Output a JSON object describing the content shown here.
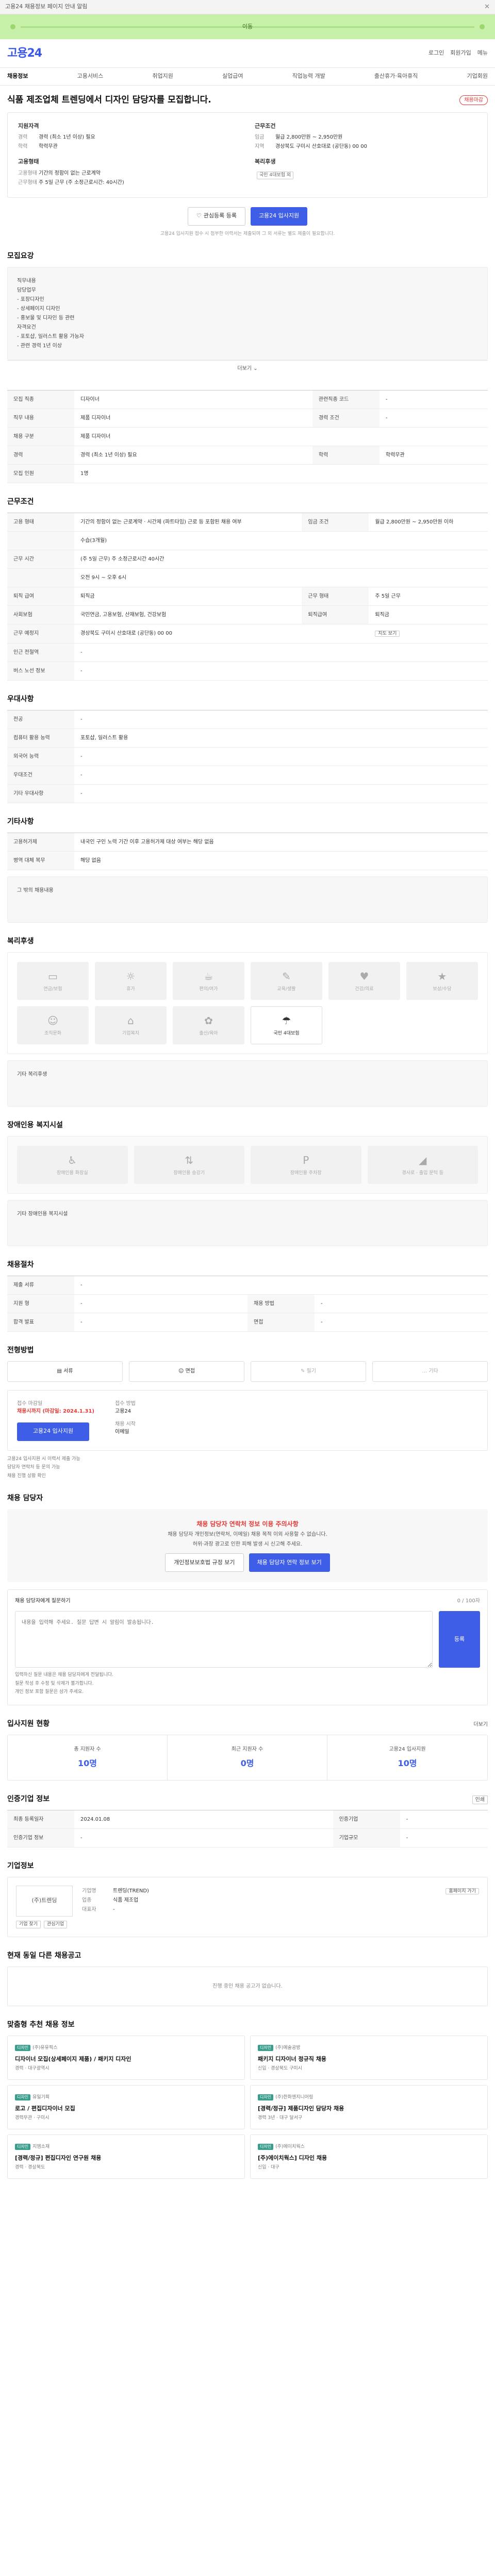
{
  "topbar": {
    "notice": "고용24 채용정보 페이지 안내 알림",
    "close": "✕"
  },
  "greenbar": {
    "text": "이동"
  },
  "header": {
    "logo": "고용24",
    "links": [
      "로그인",
      "회원가입",
      "메뉴"
    ]
  },
  "subnav": {
    "items": [
      "채용정보",
      "고용서비스",
      "취업지원",
      "실업급여",
      "직업능력 개발",
      "출산휴가·육아휴직",
      "기업회원"
    ]
  },
  "title": {
    "text": "식품 제조업체 트렌딩에서 디자인 담당자를 모집합니다.",
    "badge": "채용마감"
  },
  "summary": {
    "left_title": "지원자격",
    "left": [
      {
        "k": "경력",
        "v": "경력 (최소 1년 이상) 필요"
      },
      {
        "k": "학력",
        "v": "학력무관"
      }
    ],
    "left2_title": "고용형태",
    "left2": [
      {
        "k": "고용형태",
        "v": "기간의 정함이 없는 근로계약"
      },
      {
        "k": "근무형태",
        "v": "주 5일 근무 (주 소정근로시간: 40시간)"
      }
    ],
    "right_title": "근무조건",
    "right": [
      {
        "k": "임금",
        "v": "월급 2,800만원 ~ 2,950만원"
      },
      {
        "k": "지역",
        "v": "경상북도 구미시 산호대로 (공단동) 00 00"
      }
    ],
    "right2_title": "복리후생",
    "right2_tag": "국민 4대보험 외"
  },
  "cta": {
    "interest": "관심등록 등록",
    "apply": "고용24 입사지원",
    "note": "고용24 입사지원 접수 시 첨부한 이력서는 제출되며 그 외 서류는 별도 제출이 필요합니다."
  },
  "job_desc": {
    "heading": "모집요강",
    "lines": [
      "직무내용",
      "담당업무",
      "- 포장디자인",
      "- 상세페이지 디자인",
      "- 홍보물 및 디자인 등 관련",
      "자격요건",
      "- 포토샵, 일러스트 활용 가능자",
      "- 관련 경력 1년 이상"
    ],
    "more": "더보기"
  },
  "recruit": {
    "rows": [
      {
        "k": "모집 직종",
        "v": "디자이너",
        "k2": "관련직종 코드",
        "v2": "-"
      },
      {
        "k": "직무 내용",
        "v": "제품 디자이너",
        "k2": "경력 조건",
        "v2": "-"
      },
      {
        "k": "채용 구분",
        "v": "제품 디자이너",
        "k2": "",
        "v2": ""
      },
      {
        "k": "경력",
        "v": "경력 (최소 1년 이상) 필요",
        "k2": "학력",
        "v2": "학력무관"
      },
      {
        "k": "모집 인원",
        "v": "1명",
        "k2": "",
        "v2": ""
      }
    ]
  },
  "conditions": {
    "heading": "근무조건",
    "rows": [
      {
        "k": "고용 형태",
        "v": "기간의 정함이 없는 근로계약 · 시간제 (파트타임) 근로 등 포함된 채용 여부",
        "k2": "임금 조건",
        "v2": "월급 2,800만원 ~ 2,950만원 이하"
      },
      {
        "k": "",
        "v": "수습(3개월)",
        "k2": "",
        "v2": ""
      },
      {
        "k": "근무 시간",
        "v": "(주 5일 근무) 주 소정근로시간 40시간",
        "k2": "",
        "v2": ""
      },
      {
        "k": "",
        "v": "오전 9시 ~ 오후 6시",
        "k2": "",
        "v2": ""
      },
      {
        "k": "퇴직 급여",
        "v": "퇴직금",
        "k2": "근무 형태",
        "v2": "주 5일 근무"
      },
      {
        "k": "사회보험",
        "v": "국민연금, 고용보험, 산재보험, 건강보험",
        "k2": "퇴직급여",
        "v2": "퇴직금"
      },
      {
        "k": "근무 예정지",
        "v": "경상북도 구미시 산호대로 (공단동) 00 00",
        "k2": "",
        "v2": ""
      },
      {
        "k": "인근 전철역",
        "v": "-",
        "k2": "",
        "v2": ""
      },
      {
        "k": "버스 노선 정보",
        "v": "-",
        "k2": "",
        "v2": ""
      }
    ],
    "map": "지도 보기"
  },
  "prefer": {
    "heading": "우대사항",
    "rows": [
      {
        "k": "전공",
        "v": "-"
      },
      {
        "k": "컴퓨터 활용 능력",
        "v": "포토샵, 일러스트 활용"
      },
      {
        "k": "외국어 능력",
        "v": "-"
      },
      {
        "k": "우대조건",
        "v": "-"
      },
      {
        "k": "기타 우대사항",
        "v": "-"
      }
    ]
  },
  "other": {
    "heading": "기타사항",
    "rows": [
      {
        "k": "고용허가제",
        "v": "내국인 구인 노력 기간 이후 고용허가제 대상 여부는 해당 없음"
      },
      {
        "k": "병역 대체 복무",
        "v": "해당 없음"
      }
    ],
    "extra": "그 밖의 채용내용"
  },
  "welfare": {
    "heading": "복리후생",
    "items": [
      {
        "name": "연금/보험",
        "on": false
      },
      {
        "name": "휴가",
        "on": false
      },
      {
        "name": "편의/여가",
        "on": false
      },
      {
        "name": "교육/생활",
        "on": false
      },
      {
        "name": "건강/의료",
        "on": false
      },
      {
        "name": "보상/수당",
        "on": false
      },
      {
        "name": "조직문화",
        "on": false
      },
      {
        "name": "기업복지",
        "on": false
      },
      {
        "name": "출산/육아",
        "on": false
      },
      {
        "name": "국민 4대보험",
        "on": true
      }
    ],
    "extra": "기타 복리후생"
  },
  "disability": {
    "heading": "장애인용 복지시설",
    "items": [
      "장애인용 화장실",
      "장애인용 승강기",
      "장애인용 주차장",
      "경사로 · 출입 문턱 등"
    ],
    "extra": "기타 장애인용 복지시설"
  },
  "process": {
    "heading": "채용절차",
    "rows": [
      {
        "k": "제출 서류",
        "v": "-"
      },
      {
        "k": "지원 형",
        "v": "-",
        "k2": "채용 방법",
        "v2": "-"
      },
      {
        "k": "합격 발표",
        "v": "-",
        "k2": "면접",
        "v2": "-"
      }
    ]
  },
  "method": {
    "heading": "전형방법",
    "items": [
      {
        "name": "서류",
        "on": true
      },
      {
        "name": "면접",
        "on": true
      },
      {
        "name": "필기",
        "on": false
      },
      {
        "name": "기타",
        "on": false
      }
    ],
    "deadline_label": "접수 마감일",
    "deadline": "채용시까지 (마감일: 2024.1.31)",
    "apply_label": "접수 방법",
    "apply_v": "고용24",
    "channel_label": "채용 시작",
    "channel_v": "이메일",
    "apply_btn": "고용24 입사지원",
    "notes": [
      "고용24 입사지원 시 이력서 제출 가능",
      "담당자 연락처 등 문의 가능",
      "채용 진행 상황 확인"
    ]
  },
  "contact": {
    "heading": "채용 담당자",
    "warn": "채용 담당자 연락처 정보 이용 주의사항",
    "lines": [
      "채용 담당자 개인정보(연락처, 이메일) 채용 목적 이외 사용할 수 없습니다.",
      "허위·과장 광고로 인한 피해 발생 시 신고해 주세요."
    ],
    "btn1": "개인정보보호법 규정 보기",
    "btn2": "채용 담당자 연락 정보 보기"
  },
  "question": {
    "label": "채용 담당자에게 질문하기",
    "counter": "0 / 100자",
    "placeholder": "내용을 입력해 주세요. 질문 답변 시 알림이 발송됩니다.",
    "btn": "등록",
    "bullets": [
      "입력하신 질문 내용은 채용 담당자에게 전달됩니다.",
      "질문 작성 후 수정 및 삭제가 불가합니다.",
      "개인 정보 포함 질문은 삼가 주세요."
    ]
  },
  "status": {
    "heading": "입사지원 현황",
    "more": "더보기",
    "items": [
      {
        "name": "총 지원자 수",
        "val": "10명"
      },
      {
        "name": "최근 지원자 수",
        "val": "0명"
      },
      {
        "name": "고용24 입사지원",
        "val": "10명"
      }
    ]
  },
  "info": {
    "heading": "인증기업 정보",
    "print": "인쇄",
    "rows": [
      {
        "k": "최종 등록일자",
        "v": "2024.01.08",
        "k2": "인증기업",
        "v2": "-"
      },
      {
        "k": "인증기업 정보",
        "v": "-",
        "k2": "기업규모",
        "v2": "-"
      }
    ]
  },
  "company": {
    "heading": "기업정보",
    "logo": "(주)트렌딩",
    "btn1": "기업 찾기",
    "btn2": "관심기업",
    "rows": [
      {
        "k": "기업명",
        "v": "트렌딩(TREND)"
      },
      {
        "k": "업종",
        "v": "식품 제조업"
      },
      {
        "k": "대표자",
        "v": "-"
      }
    ],
    "visit": "홈페이지 가기"
  },
  "similar": {
    "heading": "현재 동일 다른 채용공고",
    "empty": "진행 중인 채용 공고가 없습니다."
  },
  "recommend": {
    "heading": "맞춤형 추천 채용 정보",
    "cards": [
      {
        "tag": "디자인",
        "co": "(주)유유픽스",
        "title": "디자이너 모집(상세페이지 제품) / 패키지 디자인",
        "meta": "경력 · 대구광역시"
      },
      {
        "tag": "디자인",
        "co": "(주)예술공방",
        "title": "패키지 디자이너 정규직 채용",
        "meta": "신입 · 경상북도 구미시"
      },
      {
        "tag": "디자인",
        "co": "유일기획",
        "title": "로고 / 편집디자이너 모집",
        "meta": "경력무관 · 구미시"
      },
      {
        "tag": "디자인",
        "co": "(주)한화엔지니어링",
        "title": "[경력/정규] 제품디자인 담당자 채용",
        "meta": "경력 3년 · 대구 달서구"
      },
      {
        "tag": "디자인",
        "co": "지엠소재",
        "title": "[경력/정규] 편집디자인 연구원 채용",
        "meta": "경력 · 경상북도"
      },
      {
        "tag": "디자인",
        "co": "(주)에이치웍스",
        "title": "[주)에이치웍스] 디자인 채용",
        "meta": "신입 · 대구"
      }
    ]
  }
}
